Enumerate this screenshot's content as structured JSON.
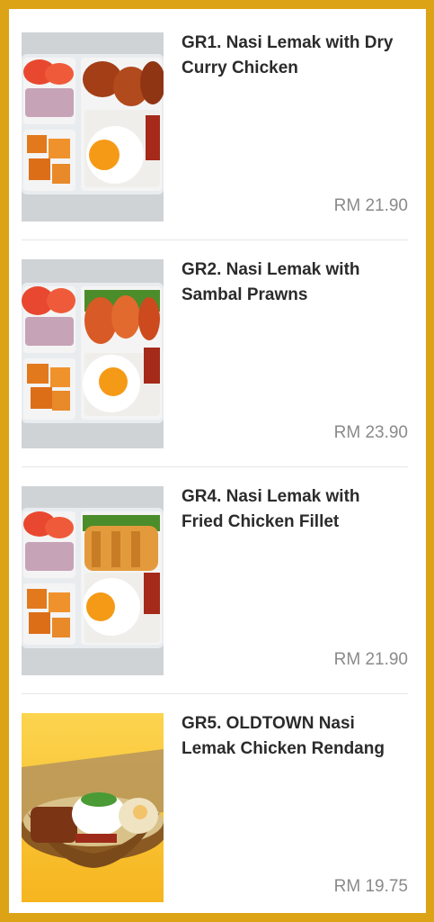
{
  "menu": {
    "items": [
      {
        "code_title": "GR1.  Nasi Lemak with Dry\nCurry Chicken",
        "price": "RM 21.90",
        "image": "bento-dry-curry-chicken"
      },
      {
        "code_title": "GR2.  Nasi Lemak with\nSambal Prawns",
        "price": "RM 23.90",
        "image": "bento-sambal-prawns"
      },
      {
        "code_title": "GR4.  Nasi Lemak with\nFried Chicken Fillet",
        "price": "RM 21.90",
        "image": "bento-fried-chicken-fillet"
      },
      {
        "code_title": "GR5. OLDTOWN Nasi\nLemak Chicken Rendang",
        "price": "RM 19.75",
        "image": "rendang-basket-yellow"
      }
    ]
  },
  "colors": {
    "frame": "#DDA316",
    "title_text": "#2b2b2b",
    "price_text": "#8a8a8a",
    "divider": "#e6e6e6"
  }
}
